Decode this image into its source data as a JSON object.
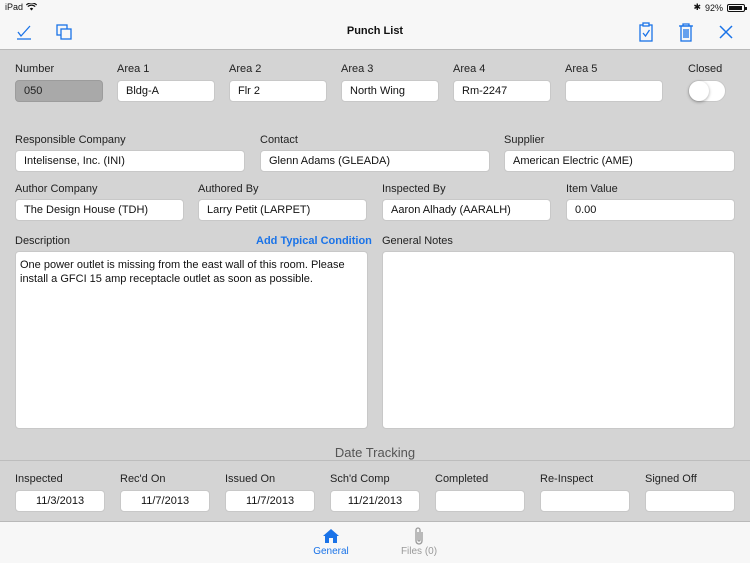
{
  "status": {
    "device": "iPad",
    "battery": "92%",
    "battery_level": 0.92
  },
  "nav": {
    "title": "Punch List"
  },
  "row1": {
    "number_label": "Number",
    "number_value": "050",
    "area1_label": "Area 1",
    "area1_value": "Bldg-A",
    "area2_label": "Area 2",
    "area2_value": "Flr 2",
    "area3_label": "Area 3",
    "area3_value": "North Wing",
    "area4_label": "Area 4",
    "area4_value": "Rm-2247",
    "area5_label": "Area 5",
    "area5_value": "",
    "closed_label": "Closed"
  },
  "row2": {
    "resp_label": "Responsible Company",
    "resp_value": "Intelisense, Inc. (INI)",
    "contact_label": "Contact",
    "contact_value": "Glenn Adams (GLEADA)",
    "supplier_label": "Supplier",
    "supplier_value": "American Electric (AME)"
  },
  "row3": {
    "author_co_label": "Author Company",
    "author_co_value": "The Design House (TDH)",
    "authored_label": "Authored By",
    "authored_value": "Larry Petit (LARPET)",
    "inspected_label": "Inspected By",
    "inspected_value": "Aaron Alhady (AARALH)",
    "item_value_label": "Item Value",
    "item_value_value": "0.00"
  },
  "notes": {
    "description_label": "Description",
    "add_condition_link": "Add Typical Condition",
    "description_text": "One power outlet is missing from the east wall of this room. Please install a GFCI 15 amp receptacle outlet as soon as possible.",
    "general_label": "General Notes",
    "general_text": ""
  },
  "dates": {
    "section_title": "Date Tracking",
    "inspected_label": "Inspected",
    "inspected_value": "11/3/2013",
    "recd_label": "Rec'd On",
    "recd_value": "11/7/2013",
    "issued_label": "Issued On",
    "issued_value": "11/7/2013",
    "schd_label": "Sch'd Comp",
    "schd_value": "11/21/2013",
    "completed_label": "Completed",
    "completed_value": "",
    "reinspect_label": "Re-Inspect",
    "reinspect_value": "",
    "signed_label": "Signed Off",
    "signed_value": ""
  },
  "tabs": {
    "general": "General",
    "files": "Files (0)"
  },
  "colors": {
    "accent": "#1a73e8",
    "background": "#d4d4d4"
  }
}
